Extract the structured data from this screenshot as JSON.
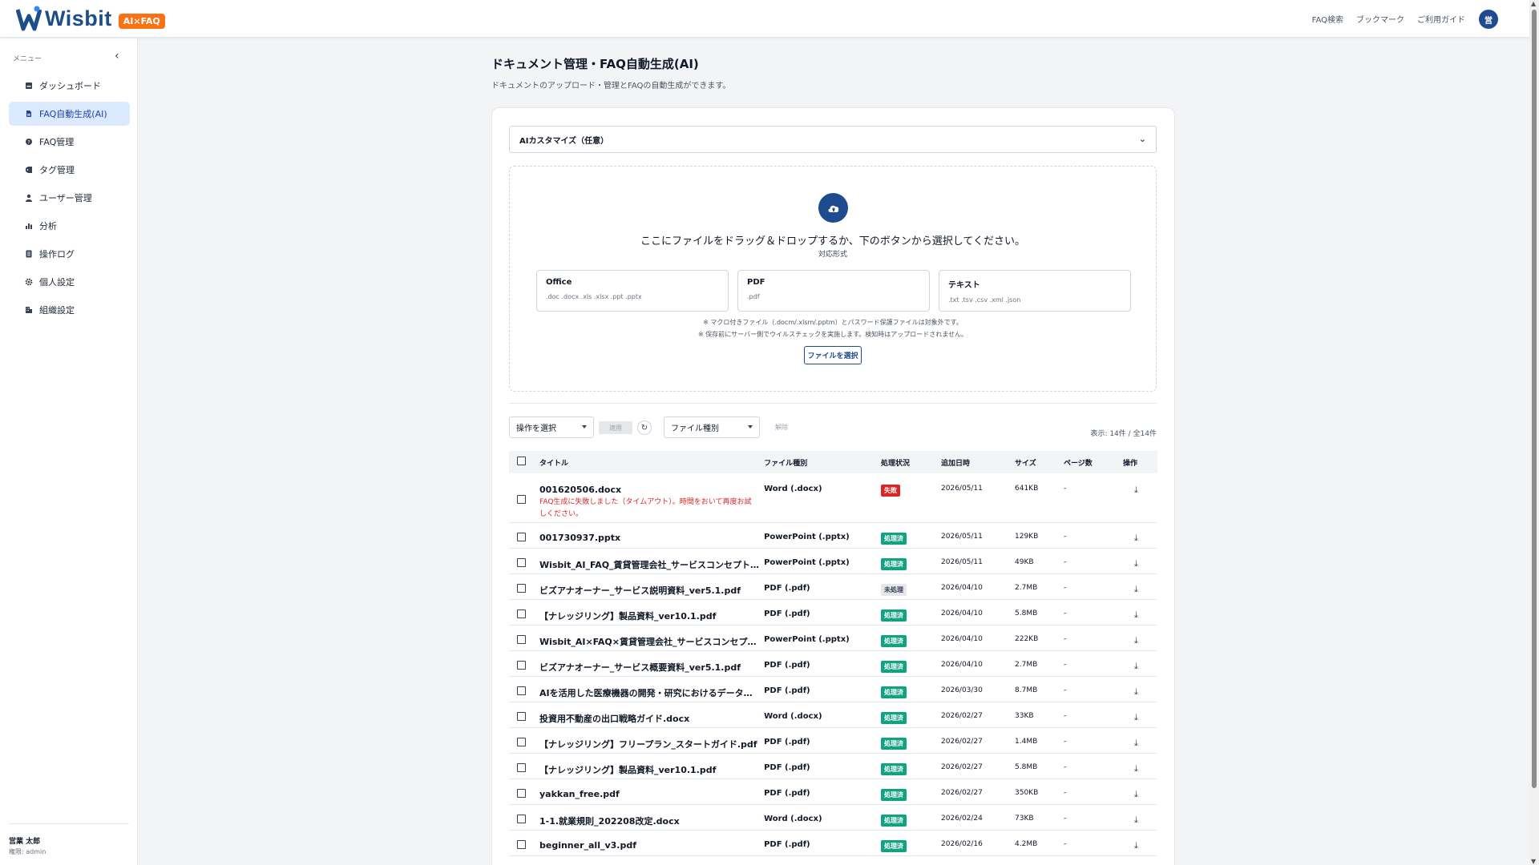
{
  "header": {
    "logo_text": "Wisbit",
    "logo_badge": "AI×FAQ",
    "nav": [
      "FAQ検索",
      "ブックマーク",
      "ご利用ガイド"
    ],
    "avatar_initial": "営",
    "brand_color": "#1e4b8f",
    "badge_color": "#f97316"
  },
  "sidebar": {
    "menu_title": "メニュー",
    "items": [
      {
        "label": "ダッシュボード",
        "icon": "dashboard-icon"
      },
      {
        "label": "FAQ自動生成(AI)",
        "icon": "document-icon",
        "active": true
      },
      {
        "label": "FAQ管理",
        "icon": "faq-icon"
      },
      {
        "label": "タグ管理",
        "icon": "tag-icon"
      },
      {
        "label": "ユーザー管理",
        "icon": "user-icon"
      },
      {
        "label": "分析",
        "icon": "chart-icon"
      },
      {
        "label": "操作ログ",
        "icon": "log-icon"
      },
      {
        "label": "個人設定",
        "icon": "gear-icon"
      },
      {
        "label": "組織設定",
        "icon": "building-icon"
      }
    ],
    "user_name": "営業 太郎",
    "user_role": "権限: admin"
  },
  "main": {
    "title": "ドキュメント管理・FAQ自動生成(AI)",
    "subtitle": "ドキュメントのアップロード・管理とFAQの自動生成ができます。",
    "ai_custom_label": "AIカスタマイズ（任意）",
    "drop_text": "ここにファイルをドラッグ＆ドロップするか、下のボタンから選択してください。",
    "formats_label": "対応形式",
    "formats": [
      {
        "name": "Office",
        "ext": ".doc .docx .xls .xlsx .ppt .pptx"
      },
      {
        "name": "PDF",
        "ext": ".pdf"
      },
      {
        "name": "テキスト",
        "ext": ".txt .tsv .csv .xml .json"
      }
    ],
    "note1": "※ マクロ付きファイル（.docm/.xlsm/.pptm）とパスワード保護ファイルは対象外です。",
    "note2": "※ 保存前にサーバー側でウイルスチェックを実施します。検知時はアップロードされません。",
    "choose_button": "ファイルを選択",
    "toolbar": {
      "action_select": "操作を選択",
      "apply": "適用",
      "filetype_select": "ファイル種別",
      "clear": "解除",
      "count": "表示: 14件 / 全14件"
    },
    "columns": [
      "タイトル",
      "ファイル種別",
      "処理状況",
      "追加日時",
      "サイズ",
      "ページ数",
      "操作"
    ],
    "rows": [
      {
        "title": "001620506.docx",
        "type": "Word (.docx)",
        "status": "失敗",
        "status_kind": "fail",
        "date": "2026/05/11",
        "size": "641KB",
        "pages": "-",
        "error": "FAQ生成に失敗しました（タイムアウト）。時間をおいて再度お試しください。"
      },
      {
        "title": "001730937.pptx",
        "type": "PowerPoint (.pptx)",
        "status": "処理済",
        "status_kind": "ok",
        "date": "2026/05/11",
        "size": "129KB",
        "pages": "-"
      },
      {
        "title": "Wisbit_AI_FAQ_賃貸管理会社_サービスコンセプト…",
        "type": "PowerPoint (.pptx)",
        "status": "処理済",
        "status_kind": "ok",
        "date": "2026/05/11",
        "size": "49KB",
        "pages": "-"
      },
      {
        "title": "ビズアナオーナー_サービス説明資料_ver5.1.pdf",
        "type": "PDF (.pdf)",
        "status": "未処理",
        "status_kind": "pending",
        "date": "2026/04/10",
        "size": "2.7MB",
        "pages": "-"
      },
      {
        "title": "【ナレッジリング】製品資料_ver10.1.pdf",
        "type": "PDF (.pdf)",
        "status": "処理済",
        "status_kind": "ok",
        "date": "2026/04/10",
        "size": "5.8MB",
        "pages": "-"
      },
      {
        "title": "Wisbit_AI×FAQ×賃貸管理会社_サービスコンセプ…",
        "type": "PowerPoint (.pptx)",
        "status": "処理済",
        "status_kind": "ok",
        "date": "2026/04/10",
        "size": "222KB",
        "pages": "-"
      },
      {
        "title": "ビズアナオーナー_サービス概要資料_ver5.1.pdf",
        "type": "PDF (.pdf)",
        "status": "処理済",
        "status_kind": "ok",
        "date": "2026/04/10",
        "size": "2.7MB",
        "pages": "-"
      },
      {
        "title": "AIを活用した医療機器の開発・研究におけるデータ…",
        "type": "PDF (.pdf)",
        "status": "処理済",
        "status_kind": "ok",
        "date": "2026/03/30",
        "size": "8.7MB",
        "pages": "-"
      },
      {
        "title": "投資用不動産の出口戦略ガイド.docx",
        "type": "Word (.docx)",
        "status": "処理済",
        "status_kind": "ok",
        "date": "2026/02/27",
        "size": "33KB",
        "pages": "-"
      },
      {
        "title": "【ナレッジリング】フリープラン_スタートガイド.pdf",
        "type": "PDF (.pdf)",
        "status": "処理済",
        "status_kind": "ok",
        "date": "2026/02/27",
        "size": "1.4MB",
        "pages": "-"
      },
      {
        "title": "【ナレッジリング】製品資料_ver10.1.pdf",
        "type": "PDF (.pdf)",
        "status": "処理済",
        "status_kind": "ok",
        "date": "2026/02/27",
        "size": "5.8MB",
        "pages": "-"
      },
      {
        "title": "yakkan_free.pdf",
        "type": "PDF (.pdf)",
        "status": "処理済",
        "status_kind": "ok",
        "date": "2026/02/27",
        "size": "350KB",
        "pages": "-"
      },
      {
        "title": "1-1.就業規則_202208改定.docx",
        "type": "Word (.docx)",
        "status": "処理済",
        "status_kind": "ok",
        "date": "2026/02/24",
        "size": "73KB",
        "pages": "-"
      },
      {
        "title": "beginner_all_v3.pdf",
        "type": "PDF (.pdf)",
        "status": "処理済",
        "status_kind": "ok",
        "date": "2026/02/16",
        "size": "4.2MB",
        "pages": "-"
      }
    ]
  }
}
